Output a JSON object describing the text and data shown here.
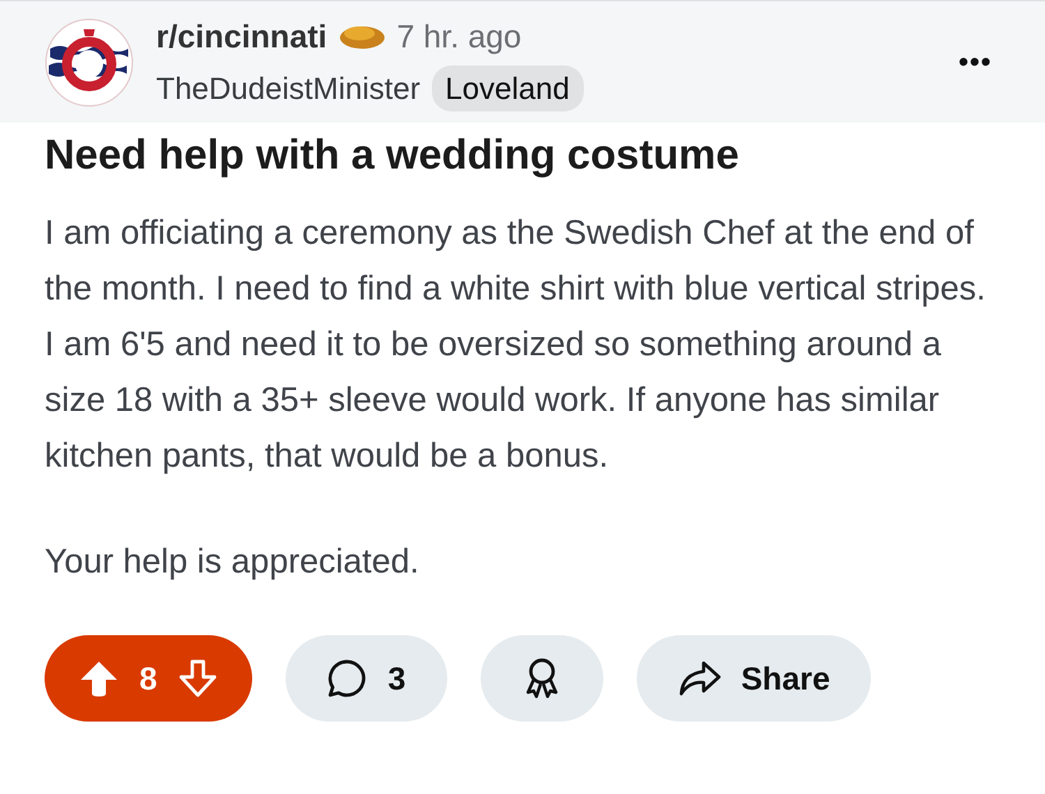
{
  "post": {
    "subreddit": "r/cincinnati",
    "time": "7 hr. ago",
    "author": "TheDudeistMinister",
    "flair": "Loveland",
    "more": "•••",
    "title": "Need help with a wedding costume",
    "paragraphs": [
      "I am officiating a ceremony as the Swedish Chef at the end of the month. I need to find a white shirt with blue vertical stripes. I am 6'5 and need it to be oversized so something around a size 18 with a 35+ sleeve would work. If anyone has similar kitchen pants, that would be a bonus.",
      "Your help is appreciated."
    ]
  },
  "actions": {
    "upvoted": true,
    "score": "8",
    "comments": "3",
    "share": "Share"
  }
}
